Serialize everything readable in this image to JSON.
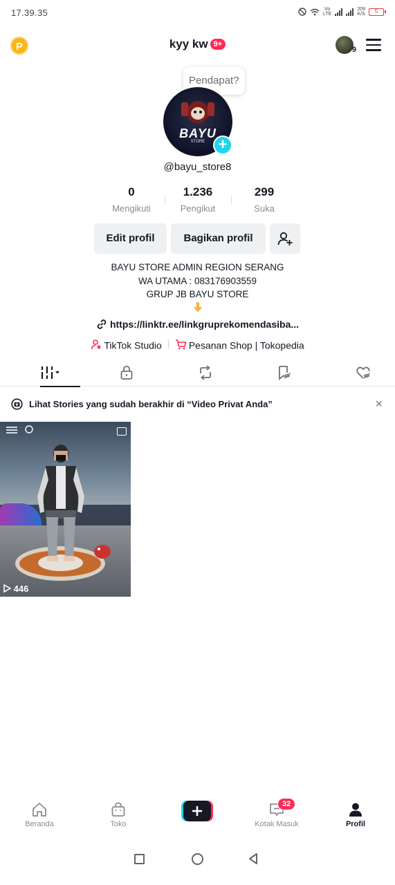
{
  "status_bar": {
    "time": "17.39.35",
    "net_speed": "209\nK/S",
    "battery": "5"
  },
  "header": {
    "coin_label": "P",
    "username": "kyy kw",
    "notification_badge": "9+",
    "avatar_count": "9"
  },
  "profile": {
    "tooltip": "Pendapat?",
    "avatar_logo": "BAYU",
    "avatar_logo_sub": "STORE",
    "handle": "@bayu_store8",
    "stats": [
      {
        "value": "0",
        "label": "Mengikuti"
      },
      {
        "value": "1.236",
        "label": "Pengikut"
      },
      {
        "value": "299",
        "label": "Suka"
      }
    ],
    "edit_button": "Edit profil",
    "share_button": "Bagikan profil",
    "bio_lines": [
      "BAYU STORE ADMIN REGION SERANG",
      "WA UTAMA : 083176903559",
      "GRUP JB BAYU STORE"
    ],
    "link": "https://linktr.ee/linkgruprekomendasiba...",
    "studio_label": "TikTok Studio",
    "shop_label": "Pesanan Shop | Tokopedia"
  },
  "tabs": [
    {
      "icon": "videos-grid-icon",
      "active": true
    },
    {
      "icon": "lock-icon",
      "active": false
    },
    {
      "icon": "repost-icon",
      "active": false
    },
    {
      "icon": "favorites-hidden-icon",
      "active": false
    },
    {
      "icon": "liked-hidden-icon",
      "active": false
    }
  ],
  "stories_banner": {
    "text": "Lihat Stories yang sudah berakhir di “Video Privat Anda”",
    "close": "×"
  },
  "videos": [
    {
      "play_count": "446"
    }
  ],
  "bottom_nav": {
    "items": [
      {
        "label": "Beranda",
        "icon": "home-icon"
      },
      {
        "label": "Toko",
        "icon": "shop-icon"
      },
      {
        "label": "",
        "icon": "create-icon"
      },
      {
        "label": "Kotak Masuk",
        "icon": "inbox-icon"
      },
      {
        "label": "Profil",
        "icon": "profile-icon"
      }
    ],
    "inbox_badge": "32"
  },
  "colors": {
    "accent": "#fe2c55",
    "cyan": "#20d5ec",
    "coin": "#f9b51a"
  }
}
